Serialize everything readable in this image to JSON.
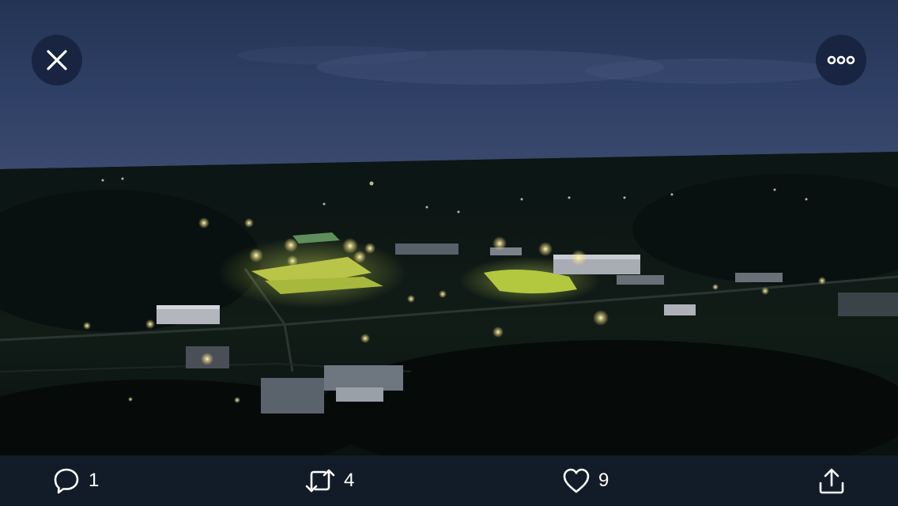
{
  "viewer": {
    "close_icon": "close-icon",
    "more_icon": "more-horizontal-icon"
  },
  "actions": {
    "reply": {
      "icon": "reply-icon",
      "count": "1"
    },
    "retweet": {
      "icon": "retweet-icon",
      "count": "4"
    },
    "like": {
      "icon": "heart-icon",
      "count": "9"
    },
    "share": {
      "icon": "share-icon"
    }
  },
  "colors": {
    "button_bg": "#16213c",
    "action_bar_bg": "#152030",
    "icon_color": "#ffffff"
  }
}
